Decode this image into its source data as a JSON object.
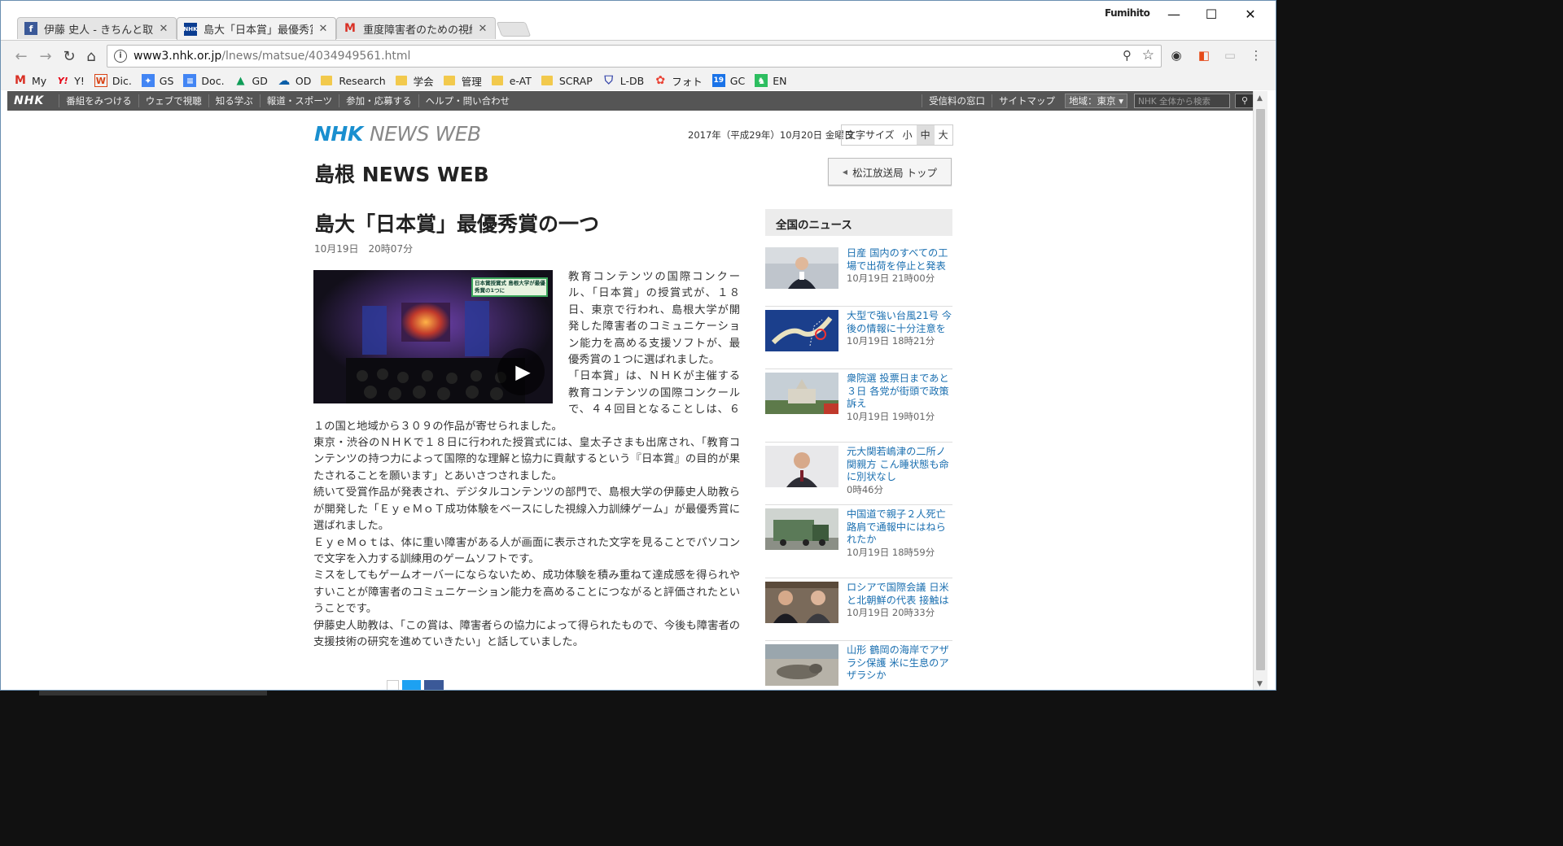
{
  "browser": {
    "user_name": "Fumihito",
    "tabs": [
      {
        "title": "伊藤 史人 - きちんと取材す",
        "favicon": "facebook-icon",
        "color": "#3b5998"
      },
      {
        "title": "島大「日本賞」最優秀賞の",
        "favicon": "nhk-icon",
        "color": "#0b3d91"
      },
      {
        "title": "重度障害者のための視線入",
        "favicon": "gmail-icon",
        "color": "#d93025"
      }
    ],
    "url_host": "www3.nhk.or.jp",
    "url_path": "/lnews/matsue/4034949561.html",
    "bookmarks": [
      {
        "label": "My",
        "icon": "gmail-icon",
        "glyph": "M",
        "color": "#d93025"
      },
      {
        "label": "Y!",
        "icon": "yahoo-icon",
        "glyph": "Y!",
        "color": "#e60012"
      },
      {
        "label": "Dic.",
        "icon": "weblio-icon",
        "glyph": "W",
        "color": "#d84315"
      },
      {
        "label": "GS",
        "icon": "google-scholar-icon",
        "glyph": "✦",
        "color": "#4285f4"
      },
      {
        "label": "Doc.",
        "icon": "google-docs-icon",
        "glyph": "≡",
        "color": "#4285f4"
      },
      {
        "label": "GD",
        "icon": "google-drive-icon",
        "glyph": "▲",
        "color": "#0f9d58"
      },
      {
        "label": "OD",
        "icon": "onedrive-icon",
        "glyph": "☁",
        "color": "#0a5ea8"
      },
      {
        "label": "Research",
        "icon": "folder-icon"
      },
      {
        "label": "学会",
        "icon": "folder-icon"
      },
      {
        "label": "管理",
        "icon": "folder-icon"
      },
      {
        "label": "e-AT",
        "icon": "folder-icon"
      },
      {
        "label": "SCRAP",
        "icon": "folder-icon"
      },
      {
        "label": "L-DB",
        "icon": "shield-icon",
        "glyph": "⛉",
        "color": "#3949ab"
      },
      {
        "label": "フォト",
        "icon": "google-photos-icon",
        "glyph": "✿",
        "color": "#ea4335"
      },
      {
        "label": "GC",
        "icon": "google-calendar-icon",
        "glyph": "19",
        "color": "#1a73e8"
      },
      {
        "label": "EN",
        "icon": "evernote-icon",
        "glyph": "♞",
        "color": "#2dbe60"
      }
    ]
  },
  "nhk_bar": {
    "logo": "NHK",
    "items": [
      "番組をみつける",
      "ウェブで視聴",
      "知る学ぶ",
      "報道・スポーツ",
      "参加・応募する",
      "ヘルプ・問い合わせ"
    ],
    "right_items": [
      "受信料の窓口",
      "サイトマップ"
    ],
    "area_label": "地域：東京",
    "search_placeholder": "NHK 全体から検索"
  },
  "header": {
    "logo_nhk": "NHK",
    "logo_newsweb": "NEWS WEB",
    "date": "2017年（平成29年）10月20日 金曜日",
    "font_size_label": "文字サイズ",
    "font_sizes": [
      "小",
      "中",
      "大"
    ],
    "region_title": "島根 NEWS WEB",
    "station_top": "松江放送局 トップ"
  },
  "article": {
    "headline": "島大「日本賞」最優秀賞の一つ",
    "time": "10月19日　20時07分",
    "video_caption": "日本賞授賞式 島根大学が最優秀賞の1つに",
    "paragraphs": [
      "教育コンテンツの国際コンクール、「日本賞」の授賞式が、１８日、東京で行われ、島根大学が開発した障害者のコミュニケーション能力を高める支援ソフトが、最優秀賞の１つに選ばれました。",
      "「日本賞」は、ＮＨＫが主催する教育コンテンツの国際コンクールで、４４回目となることしは、６１の国と地域から３０９の作品が寄せられました。",
      "東京・渋谷のＮＨＫで１８日に行われた授賞式には、皇太子さまも出席され、「教育コンテンツの持つ力によって国際的な理解と協力に貢献するという『日本賞』の目的が果たされることを願います」とあいさつされました。",
      "続いて受賞作品が発表され、デジタルコンテンツの部門で、島根大学の伊藤史人助教らが開発した「ＥｙｅＭｏＴ成功体験をベースにした視線入力訓練ゲーム」が最優秀賞に選ばれました。",
      "ＥｙｅＭｏｔは、体に重い障害がある人が画面に表示された文字を見ることでパソコンで文字を入力する訓練用のゲームソフトです。",
      "ミスをしてもゲームオーバーにならないため、成功体験を積み重ねて達成感を得られやすいことが障害者のコミュニケーション能力を高めることにつながると評価されたということです。",
      "伊藤史人助教は、「この賞は、障害者らの協力によって得られたもので、今後も障害者の支援技術の研究を進めていきたい」と話していました。"
    ]
  },
  "sidebar": {
    "heading": "全国のニュース",
    "items": [
      {
        "title": "日産 国内のすべての工場で出荷を停止と発表",
        "time": "10月19日 21時00分",
        "thumb": "press-conference"
      },
      {
        "title": "大型で強い台風21号 今後の情報に十分注意を",
        "time": "10月19日 18時21分",
        "thumb": "typhoon-map"
      },
      {
        "title": "衆院選 投票日まであと３日 各党が街頭で政策訴え",
        "time": "10月19日 19時01分",
        "thumb": "diet-building"
      },
      {
        "title": "元大関若嶋津の二所ノ関親方 こん睡状態も命に別状なし",
        "time": "0時46分",
        "thumb": "portrait"
      },
      {
        "title": "中国道で親子２人死亡 路肩で通報中にはねられたか",
        "time": "10月19日 18時59分",
        "thumb": "truck"
      },
      {
        "title": "ロシアで国際会議 日米と北朝鮮の代表 接触は",
        "time": "10月19日 20時33分",
        "thumb": "delegates"
      },
      {
        "title": "山形 鶴岡の海岸でアザラシ保護 米に生息のアザラシか",
        "time": "",
        "thumb": "seal"
      }
    ]
  },
  "colors": {
    "nhk_blue": "#1a8fcf",
    "link": "#1a6fb0",
    "nhk_bar": "#555555"
  }
}
